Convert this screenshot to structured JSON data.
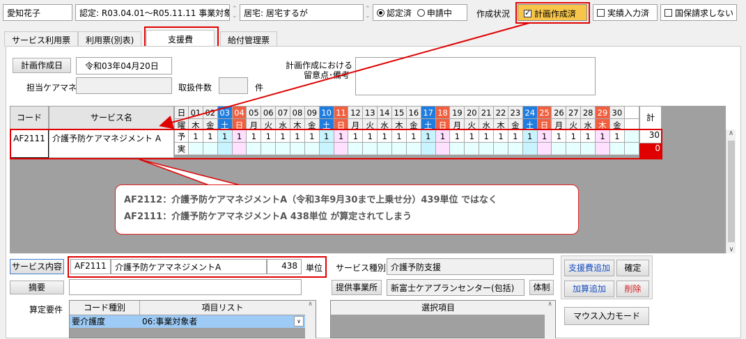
{
  "top": {
    "name": "愛知花子",
    "cert": "認定: R03.04.01～R05.11.11 事業対象",
    "home": "居宅: 居宅するが",
    "radio_certified": "認定済",
    "radio_applying": "申請中",
    "status_label": "作成状況",
    "plan_done": "計画作成済",
    "actual_done": "実績入力済",
    "no_claim": "国保請求しない"
  },
  "tabs": [
    "サービス利用票",
    "利用票(別表)",
    "支援費",
    "給付管理票"
  ],
  "plan": {
    "date_button": "計画作成日",
    "date_value": "令和03年04月20日",
    "caremanager_label": "担当ケアマネ",
    "count_label": "取扱件数",
    "count_unit": "件",
    "notes_label_1": "計画作成における",
    "notes_label_2": "留意点･備考"
  },
  "calendar": {
    "code_header": "コード",
    "name_header": "サービス名",
    "day_label": "日",
    "weekday_label": "曜",
    "total_label": "計",
    "days": [
      "01",
      "02",
      "03",
      "04",
      "05",
      "06",
      "07",
      "08",
      "09",
      "10",
      "11",
      "12",
      "13",
      "14",
      "15",
      "16",
      "17",
      "18",
      "19",
      "20",
      "21",
      "22",
      "23",
      "24",
      "25",
      "26",
      "27",
      "28",
      "29",
      "30"
    ],
    "weekdays": [
      "木",
      "金",
      "土",
      "日",
      "月",
      "火",
      "水",
      "木",
      "金",
      "土",
      "日",
      "月",
      "火",
      "水",
      "木",
      "金",
      "土",
      "日",
      "月",
      "火",
      "水",
      "木",
      "金",
      "土",
      "日",
      "月",
      "火",
      "水",
      "木",
      "金"
    ],
    "day_types": [
      "n",
      "n",
      "sat",
      "sun",
      "n",
      "n",
      "n",
      "n",
      "n",
      "sat",
      "sun",
      "n",
      "n",
      "n",
      "n",
      "n",
      "sat",
      "sun",
      "n",
      "n",
      "n",
      "n",
      "n",
      "sat",
      "sun",
      "n",
      "n",
      "n",
      "hol",
      "n"
    ],
    "row_code": "AF2111",
    "row_name": "介護予防ケアマネジメント A",
    "plan_label": "予",
    "actual_label": "実",
    "plan_values": [
      "1",
      "1",
      "1",
      "1",
      "1",
      "1",
      "1",
      "1",
      "1",
      "1",
      "1",
      "1",
      "1",
      "1",
      "1",
      "1",
      "1",
      "1",
      "1",
      "1",
      "1",
      "1",
      "1",
      "1",
      "1",
      "1",
      "1",
      "1",
      "1",
      "1"
    ],
    "plan_total": "30",
    "actual_total": "0"
  },
  "callout": {
    "line1": "AF2112：介護予防ケアマネジメントA（令和3年9月30まで上乗せ分）439単位 ではなく",
    "line2": "AF2111：介護予防ケアマネジメントA 438単位 が算定されてしまう"
  },
  "bottom": {
    "service_button": "サービス内容",
    "service_code": "AF2111",
    "service_name": "介護予防ケアマネジメントA",
    "service_units": "438",
    "unit_label": "単位",
    "service_type_label": "サービス種別",
    "service_type_value": "介護予防支援",
    "summary_button": "摘要",
    "provider_button": "提供事業所",
    "provider_value": "新富士ケアプランセンター(包括)",
    "system_button": "体制",
    "requirements_label": "算定要件",
    "code_type_header": "コード種別",
    "item_list_header": "項目リスト",
    "req_type": "要介護度",
    "req_value": "06:事業対象者",
    "selected_header": "選択項目",
    "add_support_button": "支援費追加",
    "confirm_button": "確定",
    "add_calc_button": "加算追加",
    "delete_button": "削除",
    "mouse_mode_button": "マウス入力モード"
  },
  "colors": {
    "saturday": "#1f7de0",
    "sunday": "#f06040",
    "holiday": "#f06040",
    "highlight_orange": "#f7c54a",
    "alert_red": "#e00000"
  }
}
